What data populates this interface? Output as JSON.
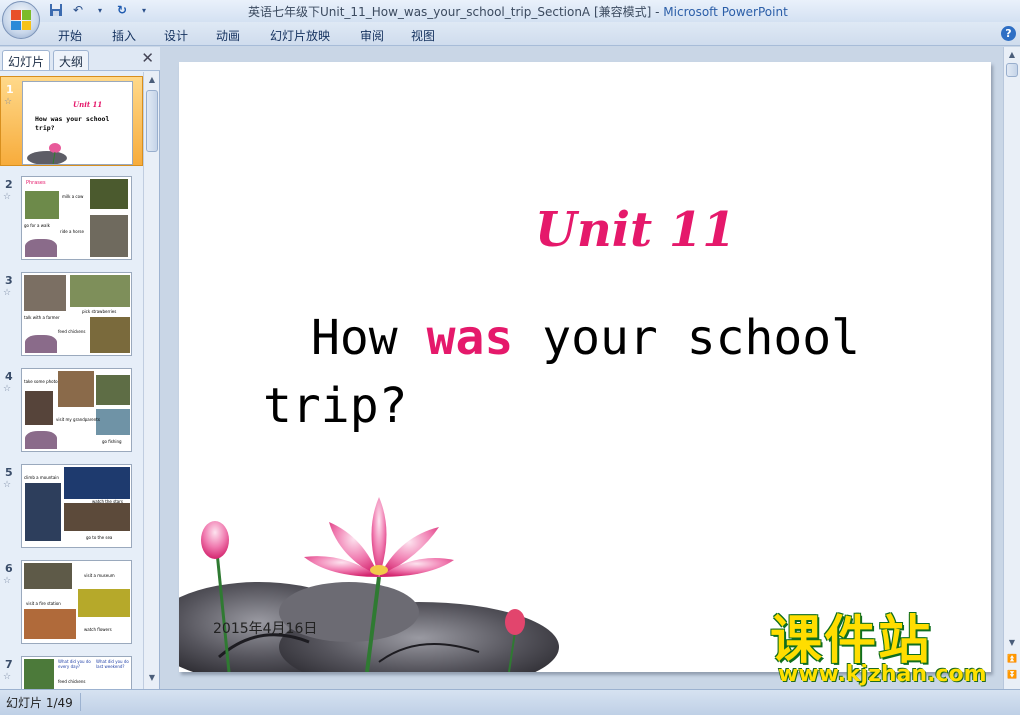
{
  "window": {
    "title": "英语七年级下Unit_11_How_was_your_school_trip_SectionA [兼容模式] - ",
    "app_name": "Microsoft PowerPoint"
  },
  "ribbon": {
    "tabs": [
      "开始",
      "插入",
      "设计",
      "动画",
      "幻灯片放映",
      "审阅",
      "视图"
    ]
  },
  "left_pane": {
    "tab_slides": "幻灯片",
    "tab_outline": "大纲",
    "thumbnails": [
      {
        "num": "1",
        "title": "Unit 11",
        "subtitle": "How was your school trip?"
      },
      {
        "num": "2",
        "title": "Phrases",
        "labels": [
          "milk a cow",
          "go for a walk",
          "ride a horse"
        ]
      },
      {
        "num": "3",
        "labels": [
          "talk with a farmer",
          "pick strawberries",
          "feed chickens"
        ]
      },
      {
        "num": "4",
        "labels": [
          "take some photos",
          "visit my grandparents",
          "go fishing"
        ]
      },
      {
        "num": "5",
        "labels": [
          "climb a mountain",
          "watch the stars",
          "go to the sea"
        ]
      },
      {
        "num": "6",
        "labels": [
          "visit a museum",
          "visit a fire station",
          "watch flowers"
        ]
      },
      {
        "num": "7",
        "labels": [
          "What did you do every day?",
          "What did you do last weekend?",
          "feed chickens"
        ]
      }
    ]
  },
  "slide": {
    "unit_title": "Unit 11",
    "line1_before": "How ",
    "line1_highlight": "was",
    "line1_after": " your school",
    "line2": "trip?",
    "date": "2015年4月16日"
  },
  "watermark": {
    "brand_cn": "课件站",
    "url": "www.kjzhan.com"
  },
  "status_bar": {
    "slide_counter": "幻灯片 1/49"
  },
  "colors": {
    "accent_pink": "#e5196b",
    "active_thumb": "#f7ac3c"
  }
}
